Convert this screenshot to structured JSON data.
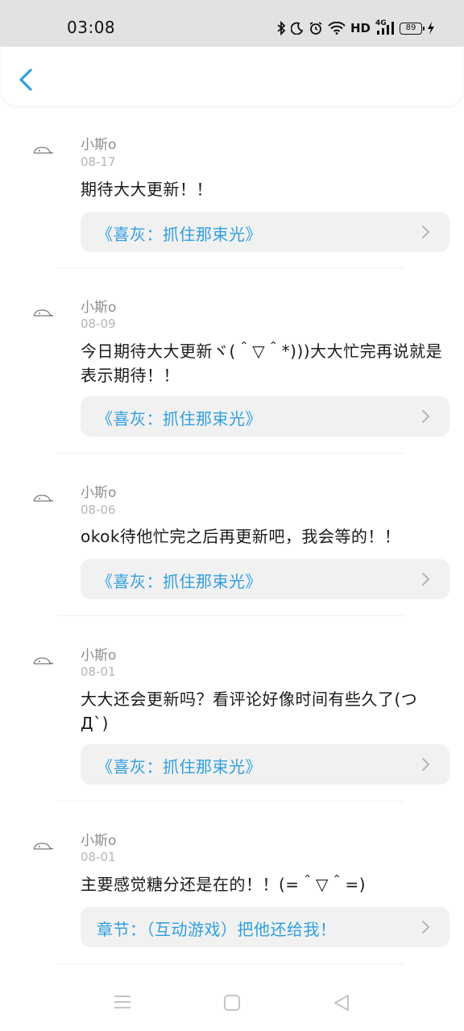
{
  "status_bar": {
    "time": "03:08",
    "icons": [
      "bluetooth-icon",
      "moon-icon",
      "alarm-icon",
      "wifi-icon",
      "hd-icon",
      "4g-signal-icon",
      "battery-icon",
      "charging-icon"
    ],
    "hd_label": "HD",
    "network_label": "4G",
    "battery_level": "89"
  },
  "header": {
    "back_icon": "chevron-left-icon"
  },
  "comments": [
    {
      "user": "小斯o",
      "date": "08-17",
      "content": "期待大大更新！！",
      "link": "《喜灰：抓住那束光》"
    },
    {
      "user": "小斯o",
      "date": "08-09",
      "content": "今日期待大大更新ヾ(＾▽＾*)))大大忙完再说就是表示期待！！",
      "link": "《喜灰：抓住那束光》"
    },
    {
      "user": "小斯o",
      "date": "08-06",
      "content": "okok待他忙完之后再更新吧，我会等的！！",
      "link": "《喜灰：抓住那束光》"
    },
    {
      "user": "小斯o",
      "date": "08-01",
      "content": "大大还会更新吗？看评论好像时间有些久了(つД`)",
      "link": "《喜灰：抓住那束光》"
    },
    {
      "user": "小斯o",
      "date": "08-01",
      "content": "主要感觉糖分还是在的！！(=＾▽＾=)",
      "link": "章节：（互动游戏）把他还给我！"
    }
  ],
  "nav_bar": {
    "buttons": [
      "menu-icon",
      "home-square-icon",
      "back-triangle-icon"
    ]
  },
  "colors": {
    "accent": "#2f9fe0",
    "status_bar_bg": "#e2e2e2",
    "card_bg": "#f1f1f1"
  }
}
